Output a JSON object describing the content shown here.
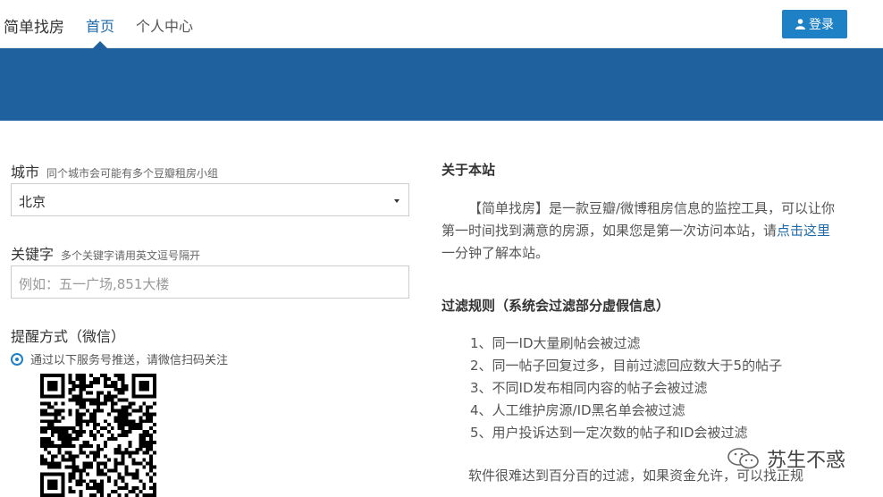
{
  "header": {
    "brand": "简单找房",
    "nav": [
      {
        "label": "首页",
        "active": true
      },
      {
        "label": "个人中心",
        "active": false
      }
    ],
    "login_label": "登录",
    "icons": {
      "login": "user-icon"
    }
  },
  "colors": {
    "banner": "#1f609e",
    "accent": "#1e81c6",
    "link": "#1e6aa8"
  },
  "form": {
    "city": {
      "label": "城市",
      "hint": "同个城市会可能有多个豆瓣租房小组",
      "value": "北京"
    },
    "keyword": {
      "label": "关键字",
      "hint": "多个关键字请用英文逗号隔开",
      "placeholder": "例如：五一广场,851大楼"
    },
    "notify": {
      "label": "提醒方式（微信）",
      "option": "通过以下服务号推送，请微信扫码关注"
    }
  },
  "about": {
    "title": "关于本站",
    "intro_before": "【简单找房】是一款豆瓣/微博租房信息的监控工具，可以让你第一时间找到满意的房源，如果您是第一次访问本站，请",
    "intro_link": "点击这里",
    "intro_after": "一分钟了解本站。",
    "filter_title": "过滤规则（系统会过滤部分虚假信息）",
    "rules": [
      "1、同一ID大量刷帖会被过滤",
      "2、同一帖子回复过多，目前过滤回应数大于5的帖子",
      "3、不同ID发布相同内容的帖子会被过滤",
      "4、人工维护房源/ID黑名单会被过滤",
      "5、用户投诉达到一定次数的帖子和ID会被过滤"
    ],
    "closing": "软件很难达到百分百的过滤，如果资金允许，可以找正规"
  },
  "watermark": {
    "text": "苏生不惑",
    "icon": "wechat-icon"
  }
}
